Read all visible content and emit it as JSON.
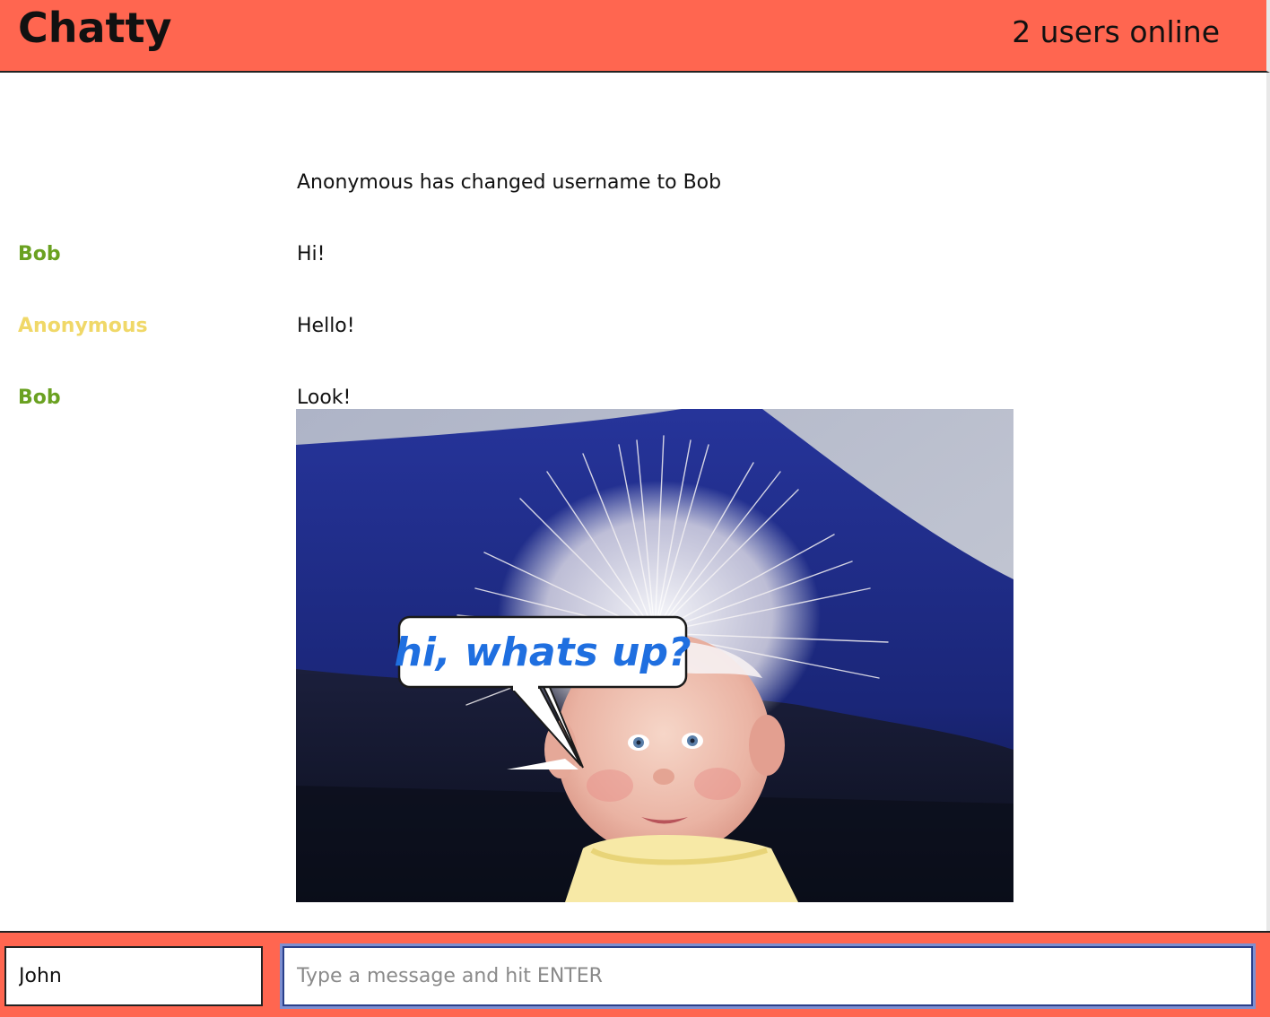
{
  "header": {
    "brand": "Chatty",
    "online_count": "2 users online",
    "background_color": "#ff6650"
  },
  "messages": [
    {
      "type": "notification",
      "content": "Anonymous has changed username to Bob"
    },
    {
      "type": "message",
      "username": "Bob",
      "username_color": "#6aa121",
      "content": "Hi!"
    },
    {
      "type": "message",
      "username": "Anonymous",
      "username_color": "#f0d868",
      "content": "Hello!"
    },
    {
      "type": "message",
      "username": "Bob",
      "username_color": "#6aa121",
      "content": "Look!",
      "image": {
        "speech_bubble_text": "hi, whats up?"
      }
    }
  ],
  "chatbar": {
    "username_value": "John",
    "message_placeholder": "Type a message and hit ENTER",
    "message_value": ""
  }
}
